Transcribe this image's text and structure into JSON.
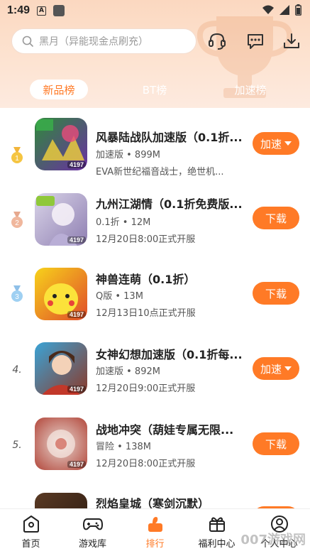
{
  "status_bar": {
    "time": "1:49",
    "a_icon_letter": "A"
  },
  "search": {
    "placeholder": "黑月（异能现金点刷充）"
  },
  "tabs": [
    {
      "label": "新品榜",
      "active": true
    },
    {
      "label": "BT榜",
      "active": false
    },
    {
      "label": "加速榜",
      "active": false
    }
  ],
  "games": [
    {
      "rank": "1",
      "rank_style": "gold-medal",
      "title": "风暴陆战队加速版（0.1折...",
      "meta": "加速版 • 899M",
      "desc": "EVA新世纪福音战士，绝世机...",
      "button": "加速",
      "button_has_dropdown": true,
      "icon_badge": "4197",
      "icon_colors": [
        "#2f8a3a",
        "#6b2fa3"
      ]
    },
    {
      "rank": "2",
      "rank_style": "silver-medal",
      "title": "九州江湖情（0.1折免费版...",
      "meta": "0.1折 • 12M",
      "desc": "12月20日8:00正式开服",
      "button": "下载",
      "button_has_dropdown": false,
      "icon_badge": "4197",
      "icon_colors": [
        "#d9d4e8",
        "#8f7fb2"
      ]
    },
    {
      "rank": "3",
      "rank_style": "bronze-medal",
      "title": "神兽连萌（0.1折）",
      "meta": "Q版 • 13M",
      "desc": "12月13日10点正式开服",
      "button": "下载",
      "button_has_dropdown": false,
      "icon_badge": "4197",
      "icon_colors": [
        "#f7d21b",
        "#e04c2a"
      ]
    },
    {
      "rank": "4.",
      "rank_style": "number",
      "title": "女神幻想加速版（0.1折每...",
      "meta": "加速版 • 892M",
      "desc": "12月20日9:00正式开服",
      "button": "加速",
      "button_has_dropdown": true,
      "icon_badge": "4197",
      "icon_colors": [
        "#3aa3d6",
        "#8b3a2a"
      ]
    },
    {
      "rank": "5.",
      "rank_style": "number",
      "title": "战地冲突（葫娃专属无限...",
      "meta": "冒险 • 138M",
      "desc": "12月20日8:00正式开服",
      "button": "下载",
      "button_has_dropdown": false,
      "icon_badge": "4197",
      "icon_colors": [
        "#e8d7d0",
        "#b2463a"
      ]
    },
    {
      "rank": "",
      "rank_style": "none",
      "title": "烈焰皇城（寒剑沉默）",
      "meta": "",
      "desc": "",
      "button": "",
      "button_has_dropdown": false,
      "icon_badge": "",
      "icon_colors": [
        "#5a3a24",
        "#2a1a10"
      ]
    }
  ],
  "bottom_nav": [
    {
      "label": "首页",
      "icon": "home-icon",
      "active": false
    },
    {
      "label": "游戏库",
      "icon": "gamepad-icon",
      "active": false
    },
    {
      "label": "排行",
      "icon": "ranking-icon",
      "active": true
    },
    {
      "label": "福利中心",
      "icon": "gift-icon",
      "active": false
    },
    {
      "label": "个人中心",
      "icon": "user-icon",
      "active": false
    }
  ],
  "watermark": "007游戏网",
  "colors": {
    "accent": "#ff7a26",
    "header_top": "#fbd8c0"
  }
}
